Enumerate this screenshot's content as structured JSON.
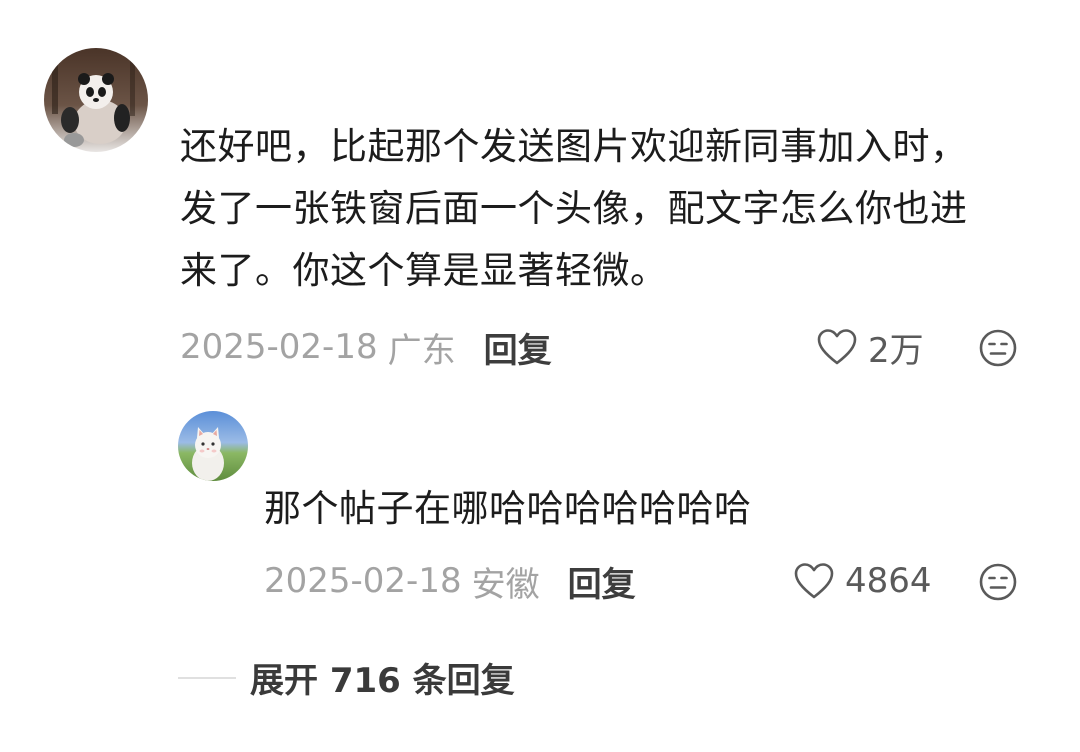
{
  "comment": {
    "text_lines": [
      "还好吧，比起那个发送图片欢迎新同事加入时，",
      "发了一张铁窗后面一个头像，配文字怎么你也进",
      "来了。你这个算是显著轻微。"
    ],
    "date": "2025-02-18",
    "location": "广东",
    "reply_label": "回复",
    "like_count": "2万",
    "avatar_icon": "panda-avatar"
  },
  "reply": {
    "text": "那个帖子在哪哈哈哈哈哈哈哈",
    "date": "2025-02-18",
    "location": "安徽",
    "reply_label": "回复",
    "like_count": "4864",
    "avatar_icon": "cat-avatar"
  },
  "expand": {
    "label": "展开 716 条回复"
  },
  "icons": {
    "like": "heart-outline-icon",
    "emoji": "neutral-face-icon"
  },
  "colors": {
    "text": "#1c1c1c",
    "meta": "#a3a3a3",
    "action": "#3d3d3d",
    "icon": "#5a5a5a"
  }
}
